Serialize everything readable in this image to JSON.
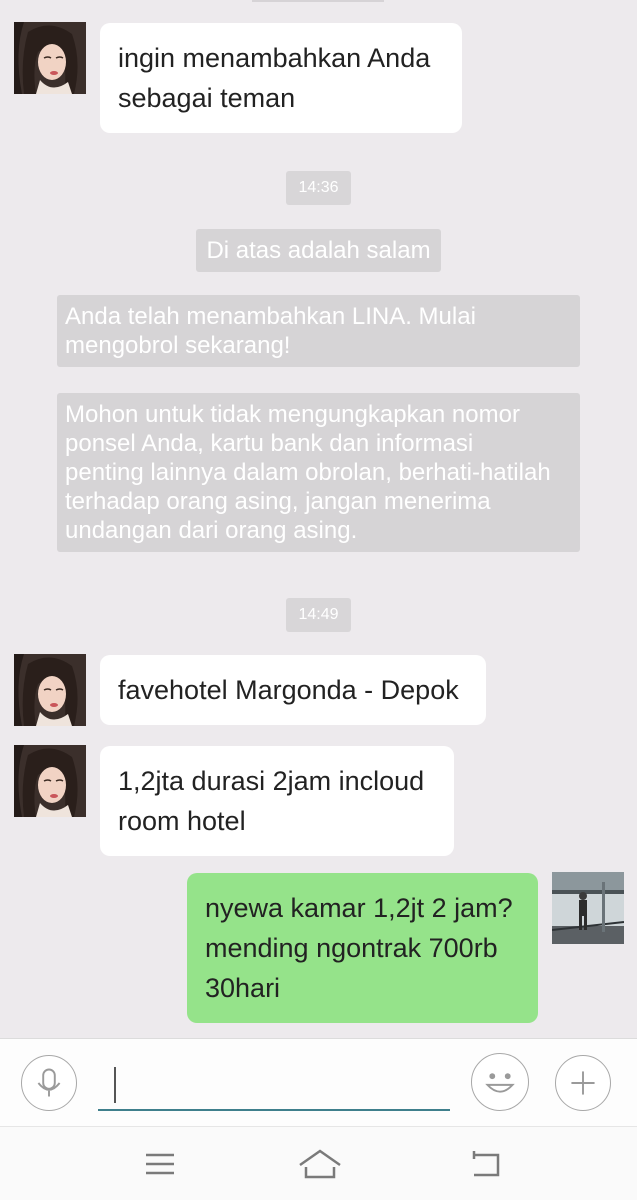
{
  "messages": [
    {
      "type": "received",
      "text": "ingin menambahkan Anda\nsebagai teman"
    },
    {
      "type": "time",
      "text": "14:36"
    },
    {
      "type": "system",
      "text": "Di atas adalah salam"
    },
    {
      "type": "system",
      "text": "Anda telah menambahkan LINA. Mulai\nmengobrol sekarang!"
    },
    {
      "type": "system",
      "text": "Mohon untuk tidak  mengungkapkan nomor\nponsel Anda, kartu bank dan informasi\npenting lainnya dalam obrolan, berhati-hatilah\nterhadap orang asing, jangan menerima\nundangan dari orang asing."
    },
    {
      "type": "time",
      "text": "14:49"
    },
    {
      "type": "received",
      "text": "favehotel Margonda - Depok"
    },
    {
      "type": "received",
      "text": "1,2jta durasi 2jam incloud\nroom hotel"
    },
    {
      "type": "sent",
      "text": "nyewa kamar 1,2jt 2 jam?\nmending ngontrak 700rb\n30hari"
    }
  ],
  "input": {
    "value": "",
    "placeholder": ""
  },
  "icons": {
    "voice": "microphone-icon",
    "emoji": "emoji-icon",
    "add": "plus-icon",
    "nav_menu": "menu-icon",
    "nav_home": "home-icon",
    "nav_back": "back-icon"
  },
  "colors": {
    "background": "#edeaed",
    "received_bubble": "#ffffff",
    "sent_bubble": "#95e38a",
    "system_chip": "#d6d4d6",
    "input_underline": "#3f7f8c"
  }
}
